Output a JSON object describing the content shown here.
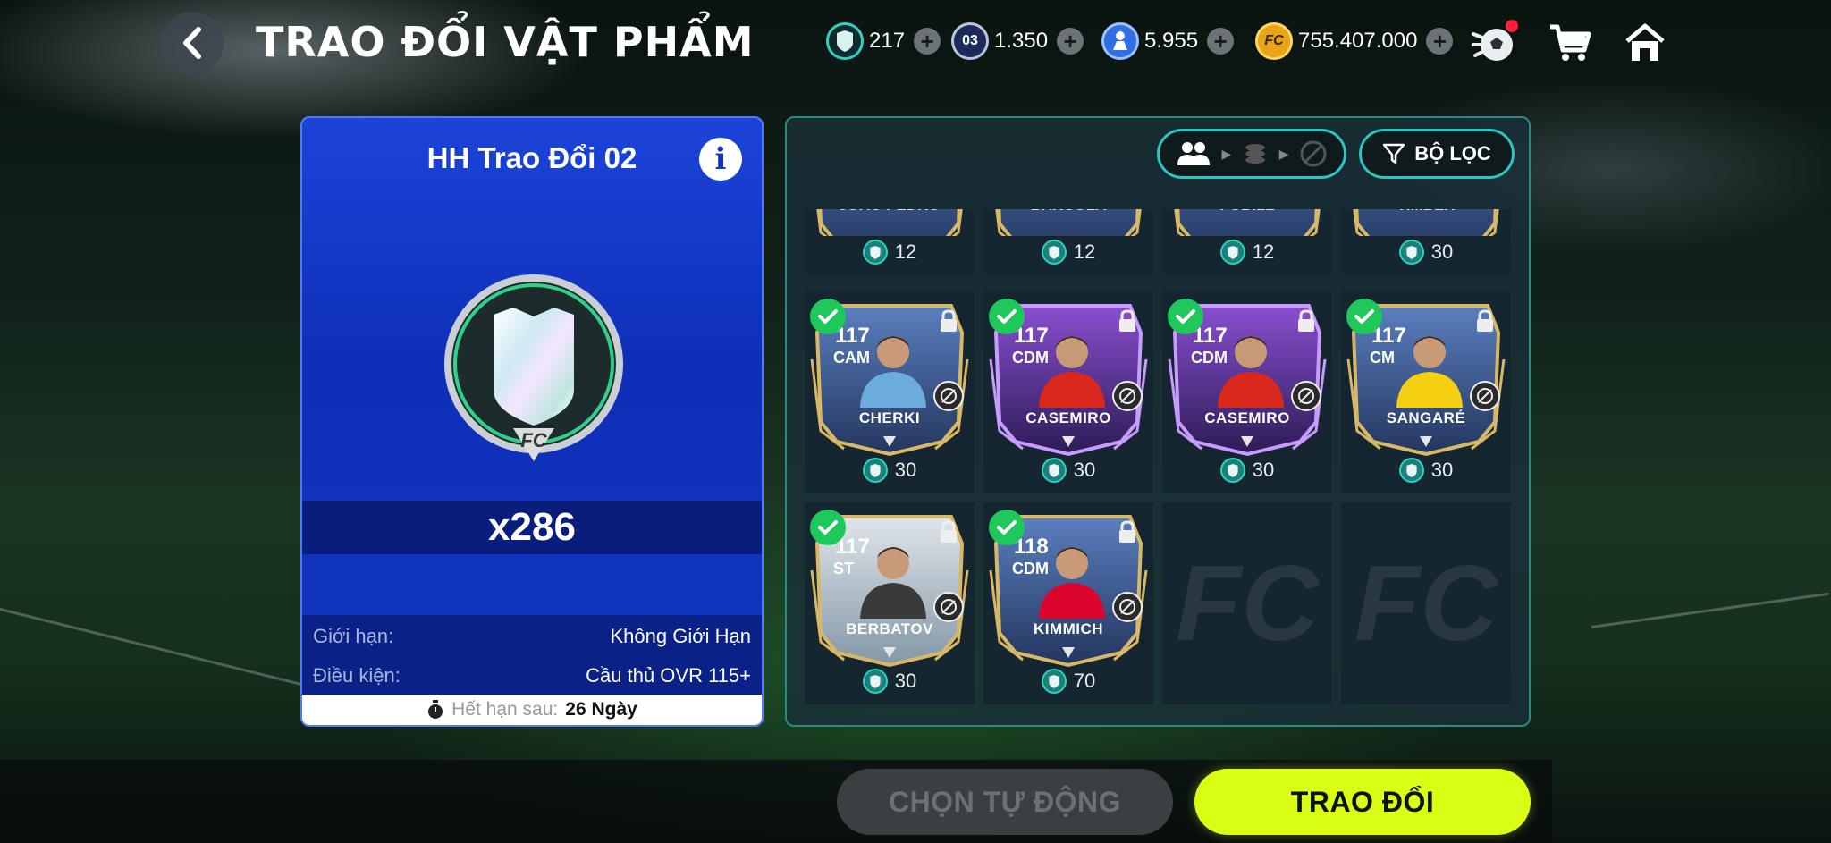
{
  "header": {
    "title": "TRAO ĐỔI VẬT PHẨM",
    "currencies": [
      {
        "name": "gem",
        "value": "217",
        "icon": "gem-icon",
        "color": "#2fd0c0"
      },
      {
        "name": "ticket-03",
        "value": "1.350",
        "icon": "ticket-03-icon",
        "label": "03",
        "color": "#1b2a5a"
      },
      {
        "name": "player-point",
        "value": "5.955",
        "icon": "player-point-icon",
        "color": "#2f6fe0"
      },
      {
        "name": "fc-coin",
        "value": "755.407.000",
        "icon": "fc-coin-icon",
        "label": "FC",
        "color": "#e8a317"
      }
    ]
  },
  "item": {
    "title": "HH Trao Đổi 02",
    "quantity": "x286",
    "limit_label": "Giới hạn:",
    "limit_value": "Không Giới Hạn",
    "condition_label": "Điều kiện:",
    "condition_value": "Cầu thủ OVR 115+",
    "expiry_label": "Hết hạn sau:",
    "expiry_value": "26 Ngày"
  },
  "filter": {
    "label": "BỘ LỌC"
  },
  "cards_top_row": [
    {
      "name": "JOAO PEDRO",
      "cost": "12"
    },
    {
      "name": "BARCOLA",
      "cost": "12"
    },
    {
      "name": "PUBILL",
      "cost": "12"
    },
    {
      "name": "TIMBER",
      "cost": "30"
    }
  ],
  "cards": [
    {
      "ovr": "117",
      "pos": "CAM",
      "name": "CHERKI",
      "cost": "30",
      "checked": true,
      "style": "blue",
      "kit": "#6cabdd"
    },
    {
      "ovr": "117",
      "pos": "CDM",
      "name": "CASEMIRO",
      "cost": "30",
      "checked": true,
      "style": "purple",
      "kit": "#da291c"
    },
    {
      "ovr": "117",
      "pos": "CDM",
      "name": "CASEMIRO",
      "cost": "30",
      "checked": true,
      "style": "purple",
      "kit": "#da291c"
    },
    {
      "ovr": "117",
      "pos": "CM",
      "name": "SANGARÉ",
      "cost": "30",
      "checked": true,
      "style": "blue",
      "kit": "#f5d010"
    },
    {
      "ovr": "117",
      "pos": "ST",
      "name": "BERBATOV",
      "cost": "30",
      "checked": true,
      "style": "silver",
      "kit": "#3a3a3a"
    },
    {
      "ovr": "118",
      "pos": "CDM",
      "name": "KIMMICH",
      "cost": "70",
      "checked": true,
      "style": "blue",
      "kit": "#dc052d"
    }
  ],
  "empty_slot_logo": "FC",
  "buttons": {
    "auto_select": "CHỌN TỰ ĐỘNG",
    "trade": "TRAO ĐỔI"
  }
}
